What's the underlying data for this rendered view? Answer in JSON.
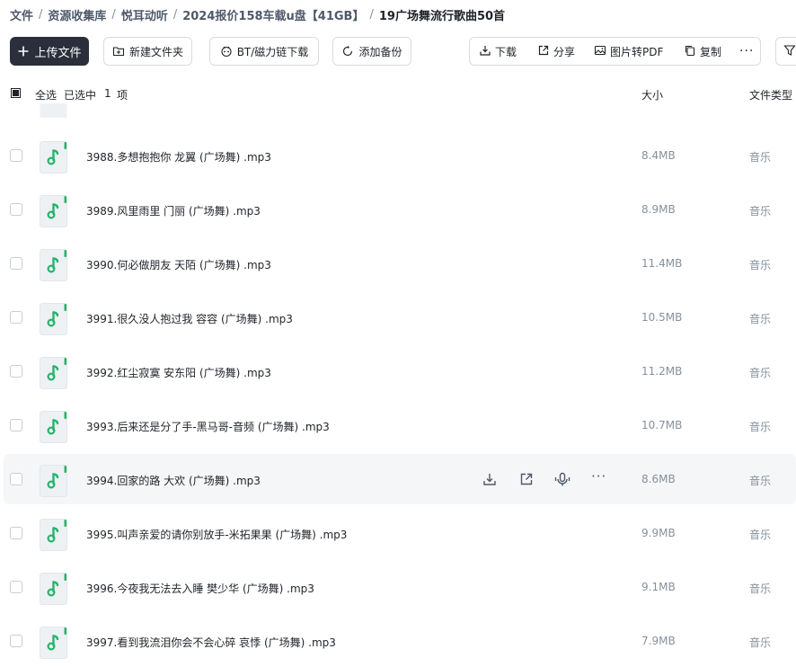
{
  "breadcrumb": [
    "文件",
    "资源收集库",
    "悦耳动听",
    "2024报价158车载u盘【41GB】",
    "19广场舞流行歌曲50首"
  ],
  "toolbar": {
    "upload": "上传文件",
    "new_folder": "新建文件夹",
    "bt_download": "BT/磁力链下载",
    "add_backup": "添加备份",
    "download": "下载",
    "share": "分享",
    "img_to_pdf": "图片转PDF",
    "copy": "复制"
  },
  "header": {
    "select_all": "全选",
    "selected": "已选中",
    "selected_count": "1",
    "selected_unit": "项",
    "size": "大小",
    "type": "文件类型"
  },
  "colors": {
    "music_icon": "#27b36b",
    "primary_button": "#2b2f3b"
  },
  "files": [
    {
      "name": "3988.多想抱抱你 龙翼 (广场舞) .mp3",
      "size": "8.4MB",
      "type": "音乐"
    },
    {
      "name": "3989.风里雨里 门丽 (广场舞) .mp3",
      "size": "8.9MB",
      "type": "音乐"
    },
    {
      "name": "3990.何必做朋友 天陌 (广场舞) .mp3",
      "size": "11.4MB",
      "type": "音乐"
    },
    {
      "name": "3991.很久没人抱过我 容容 (广场舞) .mp3",
      "size": "10.5MB",
      "type": "音乐"
    },
    {
      "name": "3992.红尘寂寞 安东阳 (广场舞) .mp3",
      "size": "11.2MB",
      "type": "音乐"
    },
    {
      "name": "3993.后来还是分了手-黑马哥-音频 (广场舞) .mp3",
      "size": "10.7MB",
      "type": "音乐"
    },
    {
      "name": "3994.回家的路 大欢 (广场舞) .mp3",
      "size": "8.6MB",
      "type": "音乐"
    },
    {
      "name": "3995.叫声亲爱的请你别放手-米拓果果 (广场舞) .mp3",
      "size": "9.9MB",
      "type": "音乐"
    },
    {
      "name": "3996.今夜我无法去入睡 樊少华 (广场舞) .mp3",
      "size": "9.1MB",
      "type": "音乐"
    },
    {
      "name": "3997.看到我流泪你会不会心碎 哀悸 (广场舞) .mp3",
      "size": "7.9MB",
      "type": "音乐"
    }
  ]
}
